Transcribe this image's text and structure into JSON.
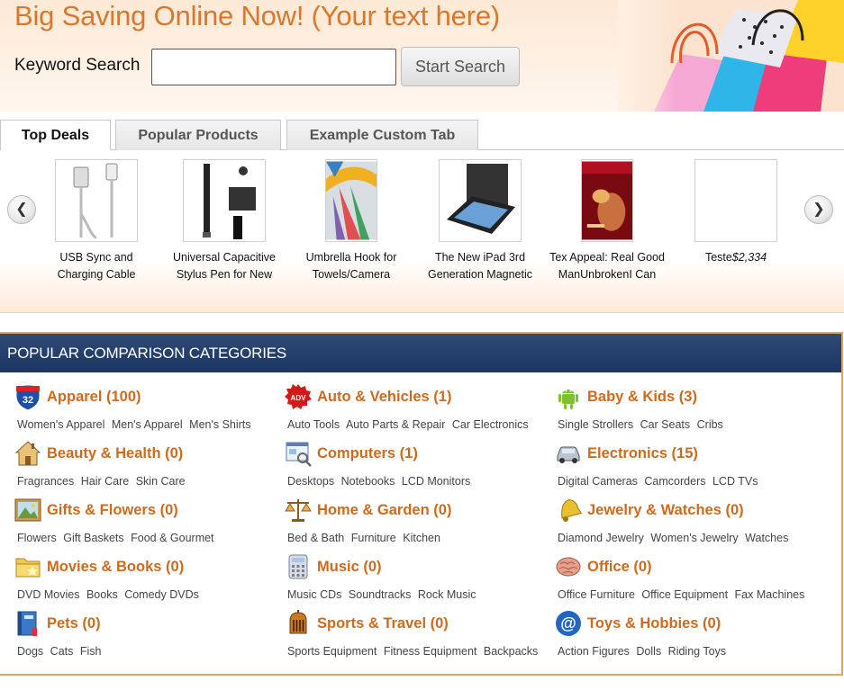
{
  "header": {
    "headline": "Big Saving Online Now! (Your text here)",
    "keyword_label": "Keyword Search",
    "search_value": "",
    "search_button": "Start Search"
  },
  "tabs": [
    {
      "label": "Top Deals",
      "active": true
    },
    {
      "label": "Popular Products",
      "active": false
    },
    {
      "label": "Example Custom Tab",
      "active": false
    }
  ],
  "carousel": {
    "prev_icon": "chevron-left-icon",
    "next_icon": "chevron-right-icon",
    "products": [
      {
        "line1": "USB Sync and",
        "line2": "Charging Cable",
        "icon": "usb-cable-image"
      },
      {
        "line1": "Universal Capacitive",
        "line2": "Stylus Pen for New",
        "icon": "stylus-pen-image"
      },
      {
        "line1": "Umbrella Hook for",
        "line2": "Towels/Camera",
        "icon": "umbrella-hook-image"
      },
      {
        "line1": "The New iPad 3rd",
        "line2": "Generation Magnetic",
        "icon": "ipad-case-image"
      },
      {
        "line1": "Tex Appeal: Real Good",
        "line2": "ManUnbrokenI Can Still",
        "icon": "book-cover-image"
      },
      {
        "name": "Teste",
        "price": "$2,334",
        "icon": "blank-image"
      }
    ]
  },
  "categories": {
    "title": "POPULAR COMPARISON CATEGORIES",
    "accent_color": "#cf6a1c",
    "items": [
      {
        "title": "Apparel (100)",
        "icon": "interstate-shield-icon",
        "subs": [
          "Women's Apparel",
          "Men's Apparel",
          "Men's Shirts"
        ]
      },
      {
        "title": "Auto & Vehicles (1)",
        "icon": "adv-badge-icon",
        "subs": [
          "Auto Tools",
          "Auto Parts & Repair",
          "Car Electronics"
        ]
      },
      {
        "title": "Baby & Kids (3)",
        "icon": "android-robot-icon",
        "subs": [
          "Single Strollers",
          "Car Seats",
          "Cribs"
        ]
      },
      {
        "title": "Beauty & Health (0)",
        "icon": "house-icon",
        "subs": [
          "Fragrances",
          "Hair Care",
          "Skin Care"
        ]
      },
      {
        "title": "Computers (1)",
        "icon": "computer-window-icon",
        "subs": [
          "Desktops",
          "Notebooks",
          "LCD Monitors"
        ]
      },
      {
        "title": "Electronics (15)",
        "icon": "car-icon",
        "subs": [
          "Digital Cameras",
          "Camcorders",
          "LCD TVs"
        ]
      },
      {
        "title": "Gifts & Flowers (0)",
        "icon": "landscape-picture-icon",
        "subs": [
          "Flowers",
          "Gift Baskets",
          "Food & Gourmet"
        ]
      },
      {
        "title": "Home & Garden (0)",
        "icon": "balance-scale-icon",
        "subs": [
          "Bed & Bath",
          "Furniture",
          "Kitchen"
        ]
      },
      {
        "title": "Jewelry & Watches (0)",
        "icon": "bell-icon",
        "subs": [
          "Diamond Jewelry",
          "Women's Jewelry",
          "Watches"
        ]
      },
      {
        "title": "Movies & Books (0)",
        "icon": "folder-icon",
        "subs": [
          "DVD Movies",
          "Books",
          "Comedy DVDs"
        ]
      },
      {
        "title": "Music (0)",
        "icon": "calculator-icon",
        "subs": [
          "Music CDs",
          "Soundtracks",
          "Rock Music"
        ]
      },
      {
        "title": "Office (0)",
        "icon": "brain-icon",
        "subs": [
          "Office Furniture",
          "Office Equipment",
          "Fax Machines"
        ]
      },
      {
        "title": "Pets (0)",
        "icon": "book-icon",
        "subs": [
          "Dogs",
          "Cats",
          "Fish"
        ]
      },
      {
        "title": "Sports & Travel (0)",
        "icon": "knight-helmet-icon",
        "subs": [
          "Sports Equipment",
          "Fitness Equipment",
          "Backpacks"
        ]
      },
      {
        "title": "Toys & Hobbies (0)",
        "icon": "at-sign-icon",
        "subs": [
          "Action Figures",
          "Dolls",
          "Riding Toys"
        ]
      }
    ]
  }
}
